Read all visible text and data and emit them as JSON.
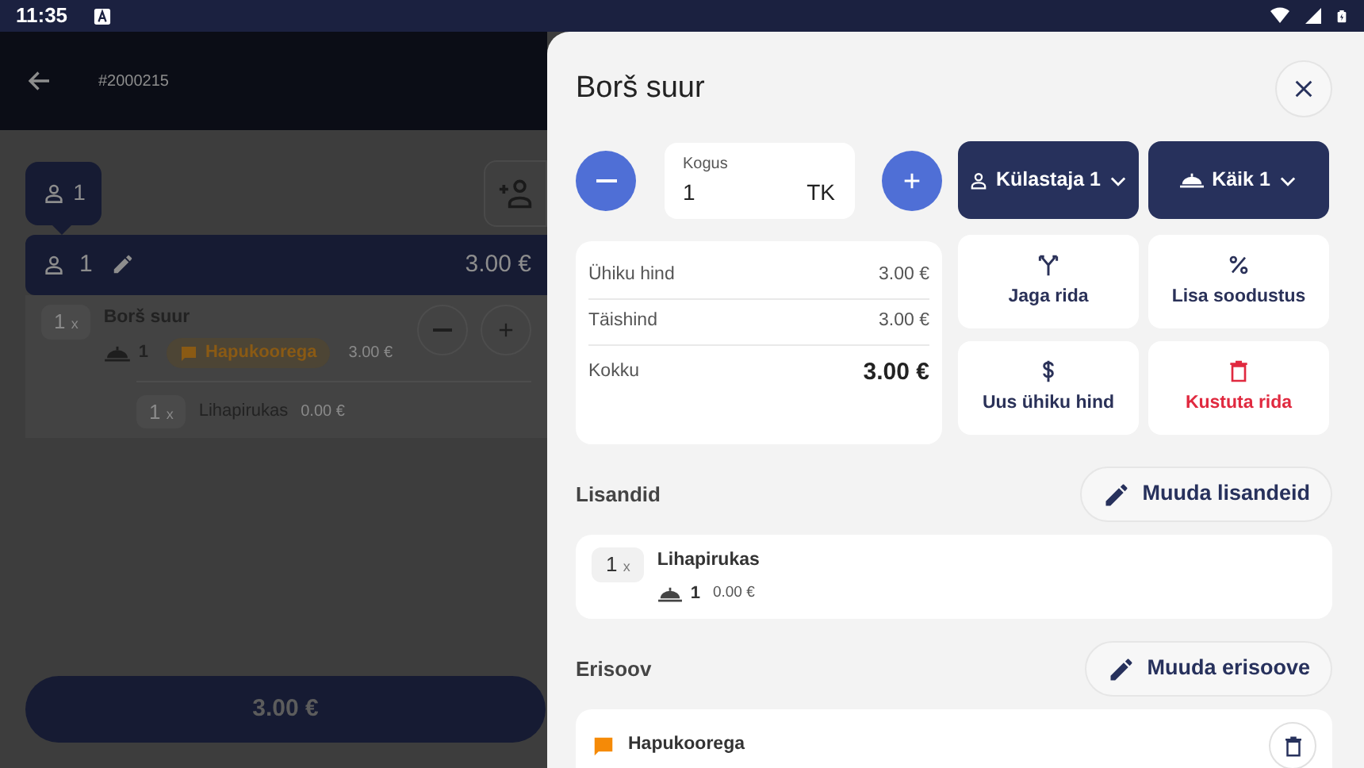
{
  "status_bar": {
    "time": "11:35"
  },
  "background": {
    "order_number": "#2000215",
    "guest_tab": {
      "label": "1",
      "selected": true
    },
    "guest_row": {
      "label": "1",
      "total": "3.00 €"
    },
    "items": [
      {
        "qty": "1",
        "times": "x",
        "name": "Borš suur",
        "course": "1",
        "note": "Hapukoorega",
        "price": "3.00 €",
        "addons": [
          {
            "qty": "1",
            "times": "x",
            "name": "Lihapirukas",
            "price": "0.00 €"
          }
        ]
      }
    ],
    "total_button": "3.00 €"
  },
  "dialog": {
    "title": "Borš suur",
    "quantity": {
      "label": "Kogus",
      "value": "1",
      "unit": "TK"
    },
    "guest_button": "Külastaja 1",
    "course_button": "Käik 1",
    "prices": [
      {
        "label": "Ühiku hind",
        "value": "3.00 €",
        "kind": "row"
      },
      {
        "label": "Täishind",
        "value": "3.00 €",
        "kind": "row"
      },
      {
        "label": "Kokku",
        "value": "3.00 €",
        "kind": "total"
      }
    ],
    "actions": [
      {
        "label": "Jaga rida",
        "kind": "split"
      },
      {
        "label": "Lisa soodustus",
        "kind": "discount"
      },
      {
        "label": "Uus ühiku hind",
        "kind": "price"
      },
      {
        "label": "Kustuta rida",
        "kind": "delete"
      }
    ],
    "addons": {
      "title": "Lisandid",
      "edit_button": "Muuda lisandeid",
      "items": [
        {
          "qty": "1",
          "times": "x",
          "name": "Lihapirukas",
          "course": "1",
          "price": "0.00 €"
        }
      ]
    },
    "special": {
      "title": "Erisoov",
      "edit_button": "Muuda erisoove",
      "items": [
        {
          "name": "Hapukoorega"
        }
      ]
    }
  }
}
